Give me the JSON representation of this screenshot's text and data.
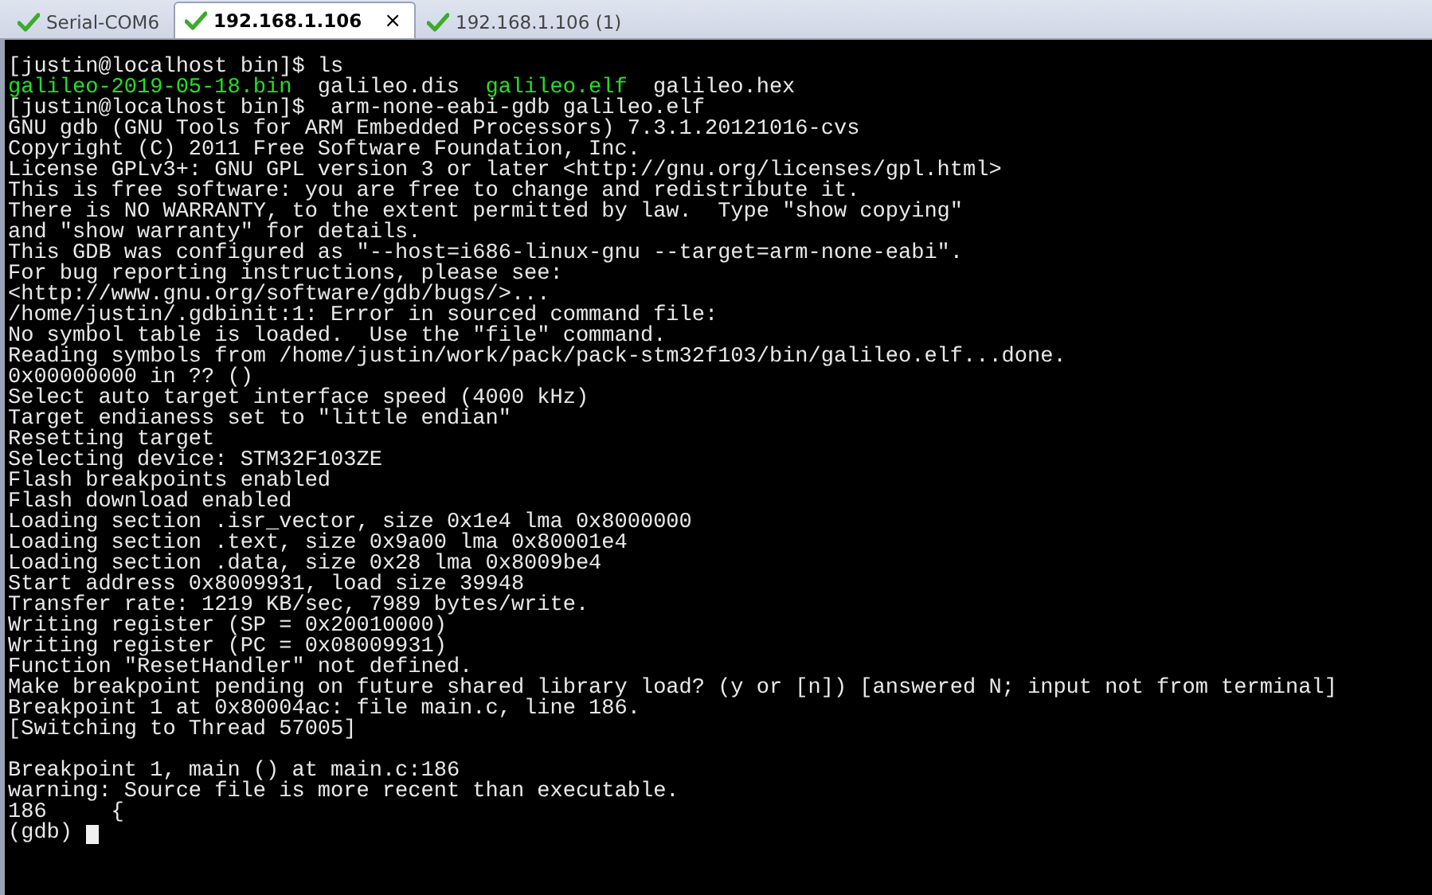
{
  "tabs": [
    {
      "label": "Serial-COM6",
      "selected": false
    },
    {
      "label": "192.168.1.106",
      "selected": true,
      "close": "×"
    },
    {
      "label": "192.168.1.106 (1)",
      "selected": false
    }
  ],
  "terminal": {
    "lines": [
      {
        "kind": "text",
        "text": "[justin@localhost bin]$ ls"
      },
      {
        "kind": "listing",
        "parts": [
          {
            "text": "galileo-2019-05-18.bin",
            "kind": "executable"
          },
          {
            "text": "galileo.dis",
            "kind": "file"
          },
          {
            "text": "galileo.elf",
            "kind": "executable"
          },
          {
            "text": "galileo.hex",
            "kind": "file"
          }
        ]
      },
      {
        "kind": "text",
        "text": "[justin@localhost bin]$  arm-none-eabi-gdb galileo.elf"
      },
      {
        "kind": "text",
        "text": "GNU gdb (GNU Tools for ARM Embedded Processors) 7.3.1.20121016-cvs"
      },
      {
        "kind": "text",
        "text": "Copyright (C) 2011 Free Software Foundation, Inc."
      },
      {
        "kind": "text",
        "text": "License GPLv3+: GNU GPL version 3 or later <http://gnu.org/licenses/gpl.html>"
      },
      {
        "kind": "text",
        "text": "This is free software: you are free to change and redistribute it."
      },
      {
        "kind": "text",
        "text": "There is NO WARRANTY, to the extent permitted by law.  Type \"show copying\""
      },
      {
        "kind": "text",
        "text": "and \"show warranty\" for details."
      },
      {
        "kind": "text",
        "text": "This GDB was configured as \"--host=i686-linux-gnu --target=arm-none-eabi\"."
      },
      {
        "kind": "text",
        "text": "For bug reporting instructions, please see:"
      },
      {
        "kind": "text",
        "text": "<http://www.gnu.org/software/gdb/bugs/>..."
      },
      {
        "kind": "text",
        "text": "/home/justin/.gdbinit:1: Error in sourced command file:"
      },
      {
        "kind": "text",
        "text": "No symbol table is loaded.  Use the \"file\" command."
      },
      {
        "kind": "text",
        "text": "Reading symbols from /home/justin/work/pack/pack-stm32f103/bin/galileo.elf...done."
      },
      {
        "kind": "text",
        "text": "0x00000000 in ?? ()"
      },
      {
        "kind": "text",
        "text": "Select auto target interface speed (4000 kHz)"
      },
      {
        "kind": "text",
        "text": "Target endianess set to \"little endian\""
      },
      {
        "kind": "text",
        "text": "Resetting target"
      },
      {
        "kind": "text",
        "text": "Selecting device: STM32F103ZE"
      },
      {
        "kind": "text",
        "text": "Flash breakpoints enabled"
      },
      {
        "kind": "text",
        "text": "Flash download enabled"
      },
      {
        "kind": "text",
        "text": "Loading section .isr_vector, size 0x1e4 lma 0x8000000"
      },
      {
        "kind": "text",
        "text": "Loading section .text, size 0x9a00 lma 0x80001e4"
      },
      {
        "kind": "text",
        "text": "Loading section .data, size 0x28 lma 0x8009be4"
      },
      {
        "kind": "text",
        "text": "Start address 0x8009931, load size 39948"
      },
      {
        "kind": "text",
        "text": "Transfer rate: 1219 KB/sec, 7989 bytes/write."
      },
      {
        "kind": "text",
        "text": "Writing register (SP = 0x20010000)"
      },
      {
        "kind": "text",
        "text": "Writing register (PC = 0x08009931)"
      },
      {
        "kind": "text",
        "text": "Function \"ResetHandler\" not defined."
      },
      {
        "kind": "text",
        "text": "Make breakpoint pending on future shared library load? (y or [n]) [answered N; input not from terminal]"
      },
      {
        "kind": "text",
        "text": "Breakpoint 1 at 0x80004ac: file main.c, line 186."
      },
      {
        "kind": "text",
        "text": "[Switching to Thread 57005]"
      },
      {
        "kind": "blank"
      },
      {
        "kind": "text",
        "text": "Breakpoint 1, main () at main.c:186"
      },
      {
        "kind": "text",
        "text": "warning: Source file is more recent than executable."
      },
      {
        "kind": "text",
        "text": "186     {"
      },
      {
        "kind": "prompt",
        "text": "(gdb)"
      }
    ]
  }
}
